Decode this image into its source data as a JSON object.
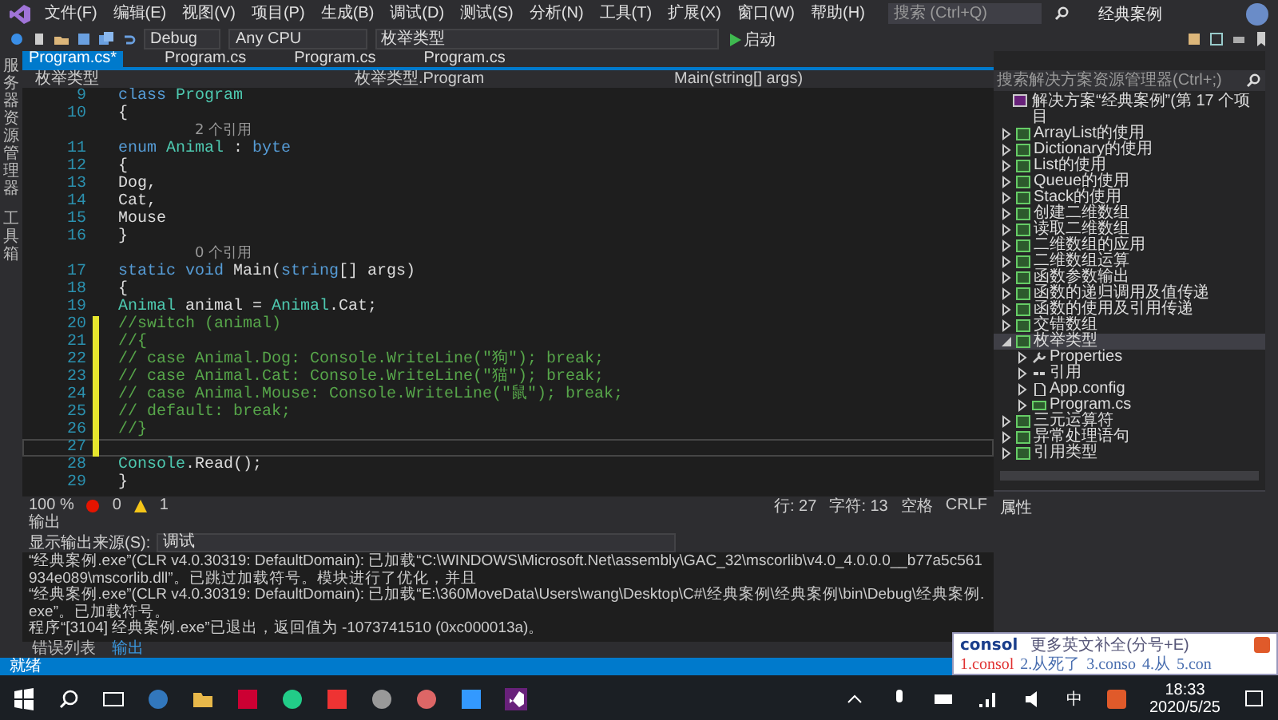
{
  "menu_bar": {
    "items": [
      "文件(F)",
      "编辑(E)",
      "视图(V)",
      "项目(P)",
      "生成(B)",
      "调试(D)",
      "测试(S)",
      "分析(N)",
      "工具(T)",
      "扩展(X)",
      "窗口(W)",
      "帮助(H)"
    ],
    "search": {
      "placeholder": "搜索 (Ctrl+Q)"
    },
    "title": "经典案例"
  },
  "toolbar": {
    "configuration": "Debug",
    "platform": "Any CPU",
    "startup_project": "枚举类型",
    "start_button": "启动"
  },
  "left_strip": [
    "服务器资源管理器",
    "工具箱"
  ],
  "editor": {
    "tabs": [
      {
        "label": "Program.cs*",
        "selected": true
      },
      {
        "label": "Program.cs",
        "selected": false
      },
      {
        "label": "Program.cs",
        "selected": false
      },
      {
        "label": "Program.cs",
        "selected": false
      }
    ],
    "nav_bar": {
      "project": "枚举类型",
      "type": "枚举类型.Program",
      "member": "Main(string[] args)"
    },
    "lines": [
      {
        "kind": "code",
        "number": "9",
        "changed": false,
        "current": false,
        "tokens": [
          {
            "kind": "keyword",
            "text": "    class "
          },
          {
            "kind": "type",
            "text": "Program"
          }
        ]
      },
      {
        "kind": "code",
        "number": "10",
        "changed": false,
        "current": false,
        "tokens": [
          {
            "kind": "plain",
            "text": "    {"
          }
        ]
      },
      {
        "kind": "hint",
        "text": "2 个引用"
      },
      {
        "kind": "code",
        "number": "11",
        "changed": false,
        "current": false,
        "tokens": [
          {
            "kind": "keyword",
            "text": "        enum "
          },
          {
            "kind": "type",
            "text": "Animal"
          },
          {
            "kind": "plain",
            "text": " : "
          },
          {
            "kind": "keyword",
            "text": "byte"
          }
        ]
      },
      {
        "kind": "code",
        "number": "12",
        "changed": false,
        "current": false,
        "tokens": [
          {
            "kind": "plain",
            "text": "        {"
          }
        ]
      },
      {
        "kind": "code",
        "number": "13",
        "changed": false,
        "current": false,
        "tokens": [
          {
            "kind": "plain",
            "text": "            Dog,"
          }
        ]
      },
      {
        "kind": "code",
        "number": "14",
        "changed": false,
        "current": false,
        "tokens": [
          {
            "kind": "plain",
            "text": "            Cat,"
          }
        ]
      },
      {
        "kind": "code",
        "number": "15",
        "changed": false,
        "current": false,
        "tokens": [
          {
            "kind": "plain",
            "text": "            Mouse"
          }
        ]
      },
      {
        "kind": "code",
        "number": "16",
        "changed": false,
        "current": false,
        "tokens": [
          {
            "kind": "plain",
            "text": "        }"
          }
        ]
      },
      {
        "kind": "hint",
        "text": "0 个引用"
      },
      {
        "kind": "code",
        "number": "17",
        "changed": false,
        "current": false,
        "tokens": [
          {
            "kind": "keyword",
            "text": "        static void "
          },
          {
            "kind": "plain",
            "text": "Main("
          },
          {
            "kind": "keyword",
            "text": "string"
          },
          {
            "kind": "plain",
            "text": "[] args)"
          }
        ]
      },
      {
        "kind": "code",
        "number": "18",
        "changed": false,
        "current": false,
        "tokens": [
          {
            "kind": "plain",
            "text": "        {"
          }
        ]
      },
      {
        "kind": "code",
        "number": "19",
        "changed": false,
        "current": false,
        "tokens": [
          {
            "kind": "type",
            "text": "            Animal "
          },
          {
            "kind": "plain",
            "text": "animal = "
          },
          {
            "kind": "type",
            "text": "Animal"
          },
          {
            "kind": "plain",
            "text": ".Cat;"
          }
        ]
      },
      {
        "kind": "code",
        "number": "20",
        "changed": true,
        "current": false,
        "tokens": [
          {
            "kind": "comment",
            "text": "            //switch (animal)"
          }
        ]
      },
      {
        "kind": "code",
        "number": "21",
        "changed": true,
        "current": false,
        "tokens": [
          {
            "kind": "comment",
            "text": "            //{"
          }
        ]
      },
      {
        "kind": "code",
        "number": "22",
        "changed": true,
        "current": false,
        "tokens": [
          {
            "kind": "comment",
            "text": "            //    case Animal.Dog: Console.WriteLine(\"狗\"); break;"
          }
        ]
      },
      {
        "kind": "code",
        "number": "23",
        "changed": true,
        "current": false,
        "tokens": [
          {
            "kind": "comment",
            "text": "            //    case Animal.Cat: Console.WriteLine(\"猫\"); break;"
          }
        ]
      },
      {
        "kind": "code",
        "number": "24",
        "changed": true,
        "current": false,
        "tokens": [
          {
            "kind": "comment",
            "text": "            //    case Animal.Mouse: Console.WriteLine(\"鼠\"); break;"
          }
        ]
      },
      {
        "kind": "code",
        "number": "25",
        "changed": true,
        "current": false,
        "tokens": [
          {
            "kind": "comment",
            "text": "            //    default: break;"
          }
        ]
      },
      {
        "kind": "code",
        "number": "26",
        "changed": true,
        "current": false,
        "tokens": [
          {
            "kind": "comment",
            "text": "            //}"
          }
        ]
      },
      {
        "kind": "code",
        "number": "27",
        "changed": true,
        "current": true
      },
      {
        "kind": "code",
        "number": "28",
        "changed": false,
        "current": false,
        "tokens": [
          {
            "kind": "type",
            "text": "            Console"
          },
          {
            "kind": "plain",
            "text": ".Read();"
          }
        ]
      },
      {
        "kind": "code",
        "number": "29",
        "changed": false,
        "current": false,
        "tokens": [
          {
            "kind": "plain",
            "text": "        }"
          }
        ]
      }
    ],
    "status": {
      "zoom": "100 %",
      "errors": "0",
      "warnings": "1",
      "line": "行: 27",
      "column": "字符: 13",
      "indent": "空格",
      "line_ending": "CRLF"
    }
  },
  "output": {
    "title": "输出",
    "source_label": "显示输出来源(S):",
    "source": "调试",
    "lines": [
      "“经典案例.exe”(CLR v4.0.30319: DefaultDomain): 已加载“C:\\WINDOWS\\Microsoft.Net\\assembly\\GAC_32\\mscorlib\\v4.0_4.0.0.0__b77a5c561934e089\\mscorlib.dll”。已跳过加载符号。模块进行了优化，并且",
      "“经典案例.exe”(CLR v4.0.30319: DefaultDomain): 已加载“E:\\360MoveData\\Users\\wang\\Desktop\\C#\\经典案例\\经典案例\\bin\\Debug\\经典案例.exe”。已加载符号。",
      "程序“[3104] 经典案例.exe”已退出，返回值为 -1073741510 (0xc000013a)。"
    ],
    "tabs": [
      {
        "label": "错误列表",
        "selected": false
      },
      {
        "label": "输出",
        "selected": true
      }
    ]
  },
  "solution_explorer": {
    "search": {
      "placeholder": "搜索解决方案资源管理器(Ctrl+;)"
    },
    "root": "解决方案“经典案例”(第 17 个项目",
    "items": [
      {
        "label": "ArrayList的使用",
        "kind": "project",
        "expanded": false,
        "selected": false
      },
      {
        "label": "Dictionary的使用",
        "kind": "project",
        "expanded": false,
        "selected": false
      },
      {
        "label": "List的使用",
        "kind": "project",
        "expanded": false,
        "selected": false
      },
      {
        "label": "Queue的使用",
        "kind": "project",
        "expanded": false,
        "selected": false
      },
      {
        "label": "Stack的使用",
        "kind": "project",
        "expanded": false,
        "selected": false
      },
      {
        "label": "创建二维数组",
        "kind": "project",
        "expanded": false,
        "selected": false
      },
      {
        "label": "读取二维数组",
        "kind": "project",
        "expanded": false,
        "selected": false
      },
      {
        "label": "二维数组的应用",
        "kind": "project",
        "expanded": false,
        "selected": false
      },
      {
        "label": "二维数组运算",
        "kind": "project",
        "expanded": false,
        "selected": false
      },
      {
        "label": "函数参数输出",
        "kind": "project",
        "expanded": false,
        "selected": false
      },
      {
        "label": "函数的递归调用及值传递",
        "kind": "project",
        "expanded": false,
        "selected": false
      },
      {
        "label": "函数的使用及引用传递",
        "kind": "project",
        "expanded": false,
        "selected": false
      },
      {
        "label": "交错数组",
        "kind": "project",
        "expanded": false,
        "selected": false
      },
      {
        "label": "枚举类型",
        "kind": "project",
        "expanded": true,
        "selected": true,
        "children": [
          {
            "label": "Properties",
            "kind": "properties",
            "expanded": false,
            "selected": false
          },
          {
            "label": "引用",
            "kind": "references",
            "expanded": false,
            "selected": false
          },
          {
            "label": "App.config",
            "kind": "config",
            "expanded": false,
            "selected": false
          },
          {
            "label": "Program.cs",
            "kind": "csharp",
            "expanded": false,
            "selected": false
          }
        ]
      },
      {
        "label": "三元运算符",
        "kind": "project",
        "expanded": false,
        "selected": false
      },
      {
        "label": "异常处理语句",
        "kind": "project",
        "expanded": false,
        "selected": false
      },
      {
        "label": "引用类型",
        "kind": "project",
        "expanded": false,
        "selected": false
      }
    ]
  },
  "properties_panel": {
    "title": "属性"
  },
  "status_bar": {
    "text": "就绪"
  },
  "taskbar": {
    "input_method": "中",
    "time": "18:33",
    "date": "2020/5/25"
  },
  "ime_popup": {
    "input": "consol",
    "hint": "更多英文补全(分号+E)",
    "candidates": [
      {
        "label": "1.consol",
        "selected": true
      },
      {
        "label": "2.从死了",
        "selected": false
      },
      {
        "label": "3.conso",
        "selected": false
      },
      {
        "label": "4.从",
        "selected": false
      },
      {
        "label": "5.con",
        "selected": false
      }
    ]
  }
}
